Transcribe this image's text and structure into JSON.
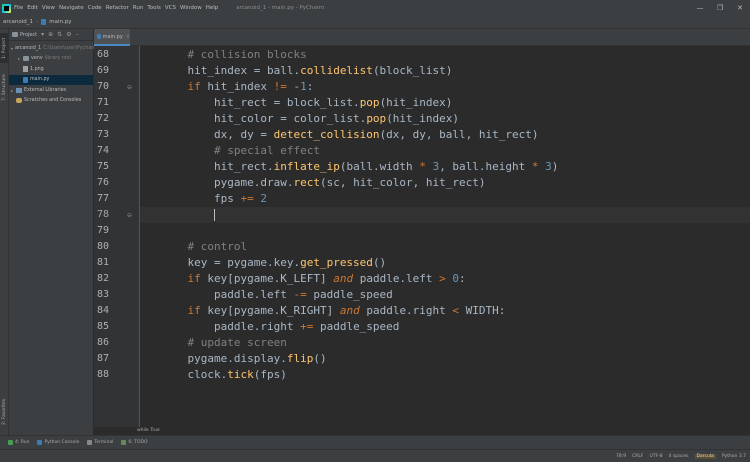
{
  "titlebar": {
    "menu": [
      "File",
      "Edit",
      "View",
      "Navigate",
      "Code",
      "Refactor",
      "Run",
      "Tools",
      "VCS",
      "Window",
      "Help"
    ],
    "window_title": "arcanoid_1 - main.py - PyCharm",
    "controls": [
      "—",
      "❐",
      "✕"
    ]
  },
  "navbar": {
    "project": "arcanoid_1",
    "file": "main.py"
  },
  "left_strip": {
    "project_tab": "1: Project",
    "structure_tab": "7: Structure",
    "favorites_tab": "2: Favorites"
  },
  "project_panel": {
    "title": "Project",
    "tree": [
      {
        "label": "arcanoid_1",
        "hint": "C:\\Users\\user\\Pycharm",
        "type": "folder",
        "indent": 0,
        "open": true
      },
      {
        "label": "venv",
        "hint": "library root",
        "type": "folder",
        "indent": 1,
        "open": false
      },
      {
        "label": "1.png",
        "hint": "",
        "type": "png",
        "indent": 1,
        "open": null
      },
      {
        "label": "main.py",
        "hint": "",
        "type": "py",
        "indent": 1,
        "open": null
      },
      {
        "label": "External Libraries",
        "hint": "",
        "type": "lib",
        "indent": 0,
        "open": false
      },
      {
        "label": "Scratches and Consoles",
        "hint": "",
        "type": "scratch",
        "indent": 0,
        "open": null
      }
    ]
  },
  "editor": {
    "tab": "main.py",
    "current_line": 78,
    "lines": [
      {
        "num": "68",
        "tokens": [
          [
            "    ",
            "t-id"
          ],
          [
            "# collision blocks",
            "t-com"
          ]
        ]
      },
      {
        "num": "69",
        "tokens": [
          [
            "    hit_index = ball.",
            "t-id"
          ],
          [
            "collidelist",
            "t-fn"
          ],
          [
            "(block_list)",
            "t-id"
          ]
        ]
      },
      {
        "num": "70",
        "tokens": [
          [
            "    ",
            "t-id"
          ],
          [
            "if",
            "t-kw"
          ],
          [
            " hit_index ",
            "t-id"
          ],
          [
            "!=",
            "t-kw"
          ],
          [
            " -",
            "t-id"
          ],
          [
            "1",
            "t-num"
          ],
          [
            ":",
            "t-id"
          ]
        ]
      },
      {
        "num": "71",
        "tokens": [
          [
            "        hit_rect = block_list.",
            "t-id"
          ],
          [
            "pop",
            "t-fn"
          ],
          [
            "(hit_index)",
            "t-id"
          ]
        ]
      },
      {
        "num": "72",
        "tokens": [
          [
            "        hit_color = color_list.",
            "t-id"
          ],
          [
            "pop",
            "t-fn"
          ],
          [
            "(hit_index)",
            "t-id"
          ]
        ]
      },
      {
        "num": "73",
        "tokens": [
          [
            "        dx, dy = ",
            "t-id"
          ],
          [
            "detect_collision",
            "t-fn"
          ],
          [
            "(dx, dy, ball, hit_rect)",
            "t-id"
          ]
        ]
      },
      {
        "num": "74",
        "tokens": [
          [
            "        ",
            "t-id"
          ],
          [
            "# special effect",
            "t-com"
          ]
        ]
      },
      {
        "num": "75",
        "tokens": [
          [
            "        hit_rect.",
            "t-id"
          ],
          [
            "inflate_ip",
            "t-fn"
          ],
          [
            "(ball.width ",
            "t-id"
          ],
          [
            "*",
            "t-kw"
          ],
          [
            " ",
            "t-id"
          ],
          [
            "3",
            "t-num"
          ],
          [
            ", ball.height ",
            "t-id"
          ],
          [
            "*",
            "t-kw"
          ],
          [
            " ",
            "t-id"
          ],
          [
            "3",
            "t-num"
          ],
          [
            ")",
            "t-id"
          ]
        ]
      },
      {
        "num": "76",
        "tokens": [
          [
            "        pygame.draw.",
            "t-id"
          ],
          [
            "rect",
            "t-fn"
          ],
          [
            "(sc, hit_color, hit_rect)",
            "t-id"
          ]
        ]
      },
      {
        "num": "77",
        "tokens": [
          [
            "        fps ",
            "t-id"
          ],
          [
            "+=",
            "t-kw"
          ],
          [
            " ",
            "t-id"
          ],
          [
            "2",
            "t-num"
          ]
        ]
      },
      {
        "num": "78",
        "tokens": [
          [
            "        ",
            "t-id"
          ]
        ]
      },
      {
        "num": "79",
        "tokens": []
      },
      {
        "num": "80",
        "tokens": [
          [
            "    ",
            "t-id"
          ],
          [
            "# control",
            "t-com"
          ]
        ]
      },
      {
        "num": "81",
        "tokens": [
          [
            "    key = pygame.key.",
            "t-id"
          ],
          [
            "get_pressed",
            "t-fn"
          ],
          [
            "()",
            "t-id"
          ]
        ]
      },
      {
        "num": "82",
        "tokens": [
          [
            "    ",
            "t-id"
          ],
          [
            "if",
            "t-kw"
          ],
          [
            " key[pygame.K_LEFT] ",
            "t-id"
          ],
          [
            "and",
            "t-it"
          ],
          [
            " paddle.left ",
            "t-id"
          ],
          [
            ">",
            "t-kw"
          ],
          [
            " ",
            "t-id"
          ],
          [
            "0",
            "t-num"
          ],
          [
            ":",
            "t-id"
          ]
        ]
      },
      {
        "num": "83",
        "tokens": [
          [
            "        paddle.left ",
            "t-id"
          ],
          [
            "-=",
            "t-kw"
          ],
          [
            " paddle_speed",
            "t-id"
          ]
        ]
      },
      {
        "num": "84",
        "tokens": [
          [
            "    ",
            "t-id"
          ],
          [
            "if",
            "t-kw"
          ],
          [
            " key[pygame.K_RIGHT] ",
            "t-id"
          ],
          [
            "and",
            "t-it"
          ],
          [
            " paddle.right ",
            "t-id"
          ],
          [
            "<",
            "t-kw"
          ],
          [
            " WIDTH:",
            "t-id"
          ]
        ]
      },
      {
        "num": "85",
        "tokens": [
          [
            "        paddle.right ",
            "t-id"
          ],
          [
            "+=",
            "t-kw"
          ],
          [
            " paddle_speed",
            "t-id"
          ]
        ]
      },
      {
        "num": "86",
        "tokens": [
          [
            "    ",
            "t-id"
          ],
          [
            "# update screen",
            "t-com"
          ]
        ]
      },
      {
        "num": "87",
        "tokens": [
          [
            "    pygame.display.",
            "t-id"
          ],
          [
            "flip",
            "t-fn"
          ],
          [
            "()",
            "t-id"
          ]
        ]
      },
      {
        "num": "88",
        "tokens": [
          [
            "    clock.",
            "t-id"
          ],
          [
            "tick",
            "t-fn"
          ],
          [
            "(fps)",
            "t-id"
          ]
        ]
      }
    ],
    "breadcrumb": "while True"
  },
  "tool_windows": [
    {
      "label": "4: Run",
      "color": "#499c54"
    },
    {
      "label": "Python Console",
      "color": "#3e7bb1"
    },
    {
      "label": "Terminal",
      "color": "#888888"
    },
    {
      "label": "6: TODO",
      "color": "#6a8759"
    }
  ],
  "statusbar": {
    "position": "78:9",
    "line_sep": "CRLF",
    "encoding": "UTF-8",
    "indent": "4 spaces",
    "branch": "Darcula",
    "interpreter": "Python 3.7"
  }
}
